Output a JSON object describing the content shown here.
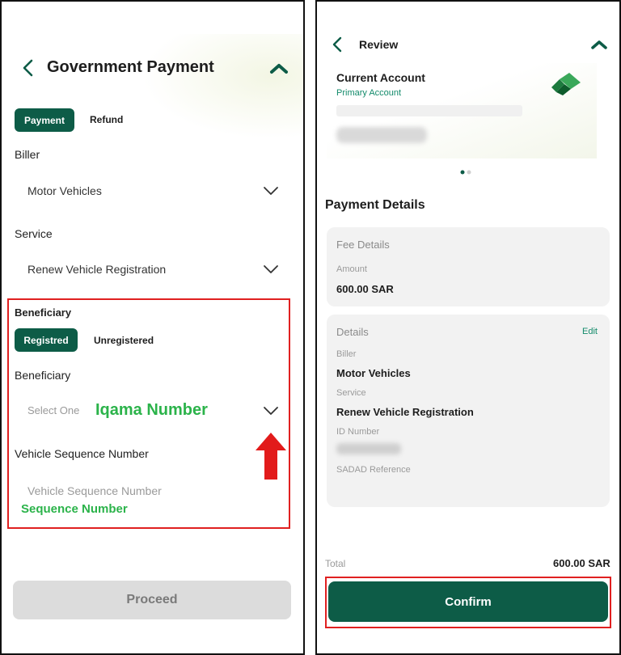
{
  "left": {
    "header": {
      "title": "Government Payment"
    },
    "segment": {
      "active": "Payment",
      "inactive": "Refund"
    },
    "biller": {
      "label": "Biller",
      "value": "Motor Vehicles"
    },
    "service": {
      "label": "Service",
      "value": "Renew Vehicle Registration"
    },
    "beneficiary": {
      "section_label": "Beneficiary",
      "toggle_active": "Registred",
      "toggle_inactive": "Unregistered",
      "field_label": "Beneficiary",
      "placeholder": "Select One",
      "annotation": "Iqama Number"
    },
    "vehicle_sequence": {
      "label": "Vehicle Sequence Number",
      "placeholder": "Vehicle Sequence Number",
      "annotation": "Sequence Number"
    },
    "proceed_label": "Proceed"
  },
  "right": {
    "header": {
      "title": "Review"
    },
    "account": {
      "name": "Current Account",
      "type": "Primary Account"
    },
    "payment_details_title": "Payment Details",
    "fee_details": {
      "heading": "Fee Details",
      "amount_label": "Amount",
      "amount_value": "600.00 SAR"
    },
    "details": {
      "heading": "Details",
      "edit_label": "Edit",
      "biller_label": "Biller",
      "biller_value": "Motor Vehicles",
      "service_label": "Service",
      "service_value": "Renew Vehicle Registration",
      "id_label": "ID Number",
      "sadad_label": "SADAD Reference"
    },
    "total": {
      "label": "Total",
      "value": "600.00 SAR"
    },
    "confirm_label": "Confirm"
  },
  "colors": {
    "brand_green": "#0d5c47",
    "link_green": "#128a6a",
    "highlight_red": "#e02020",
    "annotation_green": "#2bb34a"
  },
  "icons": [
    "back-chevron-icon",
    "collapse-chevron-icon",
    "dropdown-chevron-icon",
    "red-up-arrow",
    "bank-logo-icon",
    "pager-dots"
  ]
}
